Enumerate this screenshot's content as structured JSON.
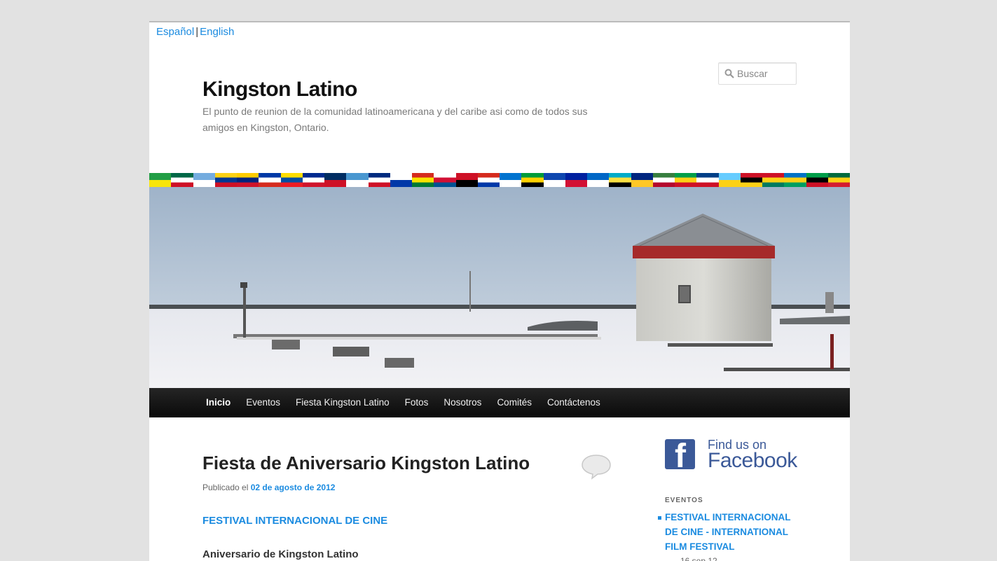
{
  "lang": {
    "es": "Español",
    "separator": "|",
    "en": "English"
  },
  "site": {
    "title": "Kingston Latino",
    "description": "El punto de reunion de la comunidad latinoamericana y del caribe asi como de todos sus amigos en Kingston, Ontario."
  },
  "search": {
    "placeholder": "Buscar",
    "icon": "search-icon"
  },
  "flags": [
    {
      "name": "Brazil",
      "colors": [
        "#229e45",
        "#f8e509"
      ]
    },
    {
      "name": "Mexico",
      "colors": [
        "#006847",
        "#ffffff",
        "#ce1126"
      ]
    },
    {
      "name": "Argentina",
      "colors": [
        "#74acdf",
        "#ffffff"
      ]
    },
    {
      "name": "Colombia",
      "colors": [
        "#fcd116",
        "#003893",
        "#ce1126"
      ]
    },
    {
      "name": "Venezuela",
      "colors": [
        "#ffcc00",
        "#00247d",
        "#cf142b"
      ]
    },
    {
      "name": "Chile",
      "colors": [
        "#0039a6",
        "#ffffff",
        "#d52b1e"
      ]
    },
    {
      "name": "Ecuador",
      "colors": [
        "#ffdd00",
        "#034ea2",
        "#ed1c24"
      ]
    },
    {
      "name": "Cuba",
      "colors": [
        "#002a8f",
        "#ffffff",
        "#cf142b"
      ]
    },
    {
      "name": "Dominican Republic",
      "colors": [
        "#002d62",
        "#ce1126"
      ]
    },
    {
      "name": "Guatemala",
      "colors": [
        "#4997d0",
        "#ffffff"
      ]
    },
    {
      "name": "Costa Rica",
      "colors": [
        "#002b7f",
        "#ffffff",
        "#ce1126"
      ]
    },
    {
      "name": "Uruguay",
      "colors": [
        "#ffffff",
        "#0038a8"
      ]
    },
    {
      "name": "Bolivia",
      "colors": [
        "#d52b1e",
        "#f9e300",
        "#007934"
      ]
    },
    {
      "name": "Panama",
      "colors": [
        "#ffffff",
        "#d21034",
        "#005293"
      ]
    },
    {
      "name": "Trinidad and Tobago",
      "colors": [
        "#ce1126",
        "#000000"
      ]
    },
    {
      "name": "Paraguay",
      "colors": [
        "#d52b1e",
        "#ffffff",
        "#0038a8"
      ]
    },
    {
      "name": "Honduras",
      "colors": [
        "#0073cf",
        "#ffffff"
      ]
    },
    {
      "name": "Jamaica",
      "colors": [
        "#009b3a",
        "#fed100",
        "#000000"
      ]
    },
    {
      "name": "El Salvador",
      "colors": [
        "#0f47af",
        "#ffffff"
      ]
    },
    {
      "name": "Haiti",
      "colors": [
        "#00209f",
        "#d21034"
      ]
    },
    {
      "name": "Nicaragua",
      "colors": [
        "#0067c6",
        "#ffffff"
      ]
    },
    {
      "name": "Bahamas",
      "colors": [
        "#00abc9",
        "#fae042",
        "#000000"
      ]
    },
    {
      "name": "Barbados",
      "colors": [
        "#00267f",
        "#ffc726"
      ]
    },
    {
      "name": "Suriname",
      "colors": [
        "#377e3f",
        "#ffffff",
        "#b40a2d"
      ]
    },
    {
      "name": "Guyana",
      "colors": [
        "#009e49",
        "#fcd116",
        "#ce1126"
      ]
    },
    {
      "name": "Belize",
      "colors": [
        "#003f87",
        "#ffffff",
        "#ce1126"
      ]
    },
    {
      "name": "Saint Lucia",
      "colors": [
        "#66ccff",
        "#fcd116"
      ]
    },
    {
      "name": "Antigua and Barbuda",
      "colors": [
        "#ce1126",
        "#000000",
        "#fcd116"
      ]
    },
    {
      "name": "Grenada",
      "colors": [
        "#ce1126",
        "#fcd116",
        "#007a5e"
      ]
    },
    {
      "name": "Saint Vincent",
      "colors": [
        "#0072c6",
        "#fcd116",
        "#009e60"
      ]
    },
    {
      "name": "Saint Kitts and Nevis",
      "colors": [
        "#009e49",
        "#000000",
        "#ce1126"
      ]
    },
    {
      "name": "Dominica",
      "colors": [
        "#006b3f",
        "#fcd116",
        "#d41c30"
      ]
    }
  ],
  "nav": {
    "items": [
      {
        "label": "Inicio",
        "active": true
      },
      {
        "label": "Eventos",
        "active": false
      },
      {
        "label": "Fiesta Kingston Latino",
        "active": false
      },
      {
        "label": "Fotos",
        "active": false
      },
      {
        "label": "Nosotros",
        "active": false
      },
      {
        "label": "Comités",
        "active": false
      },
      {
        "label": "Contáctenos",
        "active": false
      }
    ]
  },
  "post": {
    "title": "Fiesta de Aniversario Kingston Latino",
    "meta_prefix": "Publicado el",
    "date": "02 de agosto de 2012",
    "link": "FESTIVAL INTERNACIONAL DE CINE",
    "subheading": "Aniversario de Kingston Latino"
  },
  "sidebar": {
    "facebook": {
      "find": "Find us on",
      "name": "Facebook",
      "logo_letter": "f",
      "color": "#3b5998"
    },
    "events_title": "EVENTOS",
    "events": [
      {
        "title": "FESTIVAL INTERNACIONAL DE CINE - INTERNATIONAL FILM FESTIVAL",
        "date": "16 sep 12"
      }
    ]
  },
  "colors": {
    "link": "#1b8be0",
    "nav_bg": "#111111",
    "page_bg": "#e2e2e2"
  }
}
